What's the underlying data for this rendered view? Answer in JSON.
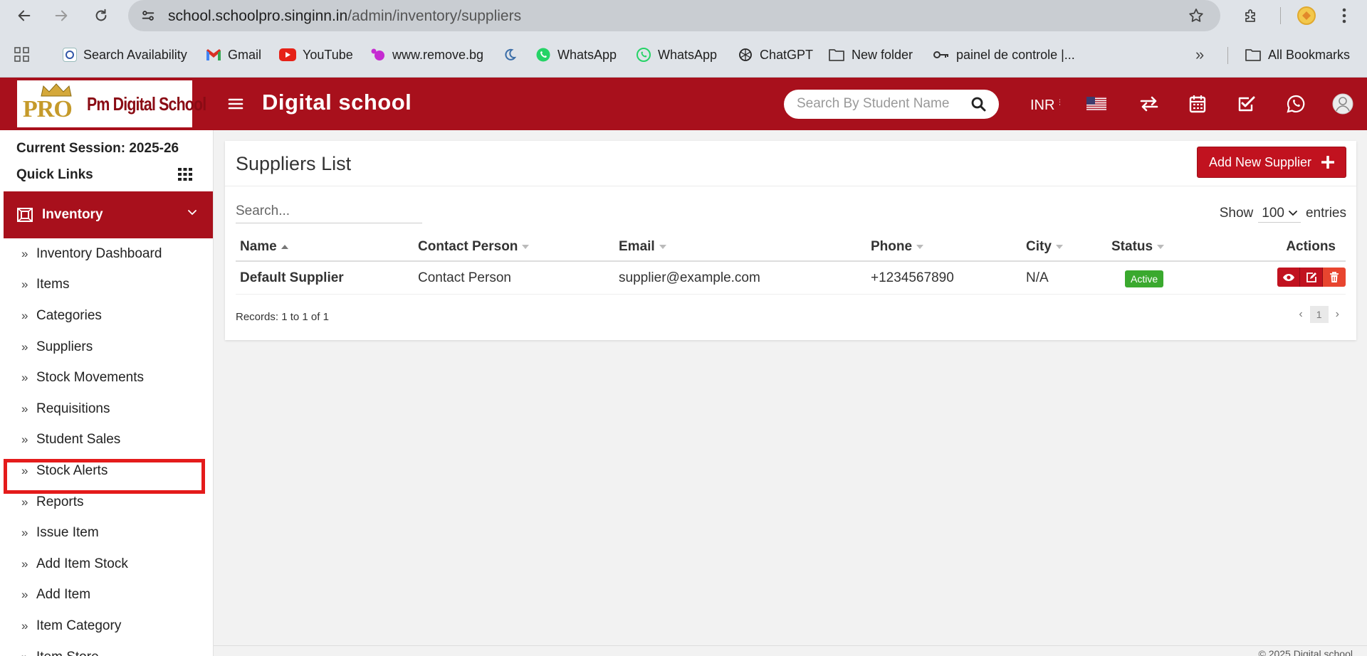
{
  "browser": {
    "url_host": "school.schoolpro.singinn.in",
    "url_path": "/admin/inventory/suppliers",
    "bookmarks": [
      {
        "label": "Search Availability",
        "icon": "site-icon"
      },
      {
        "label": "Gmail",
        "icon": "gmail-icon"
      },
      {
        "label": "YouTube",
        "icon": "youtube-icon"
      },
      {
        "label": "www.remove.bg",
        "icon": "removebg-icon"
      },
      {
        "label": "",
        "icon": "moon-icon"
      },
      {
        "label": "WhatsApp",
        "icon": "whatsapp-icon"
      },
      {
        "label": "WhatsApp",
        "icon": "whatsapp-outline-icon"
      },
      {
        "label": "ChatGPT",
        "icon": "chatgpt-icon"
      },
      {
        "label": "New folder",
        "icon": "folder-icon"
      },
      {
        "label": "painel de controle |...",
        "icon": "key-icon"
      }
    ],
    "more": "»",
    "all_bookmarks": "All Bookmarks"
  },
  "header": {
    "logo_pro": "PRO",
    "logo_name": "Pm Digital School",
    "title": "Digital school",
    "search_placeholder": "Search By Student Name",
    "currency": "INR ₹"
  },
  "sidebar": {
    "session": "Current Session: 2025-26",
    "quick_links": "Quick Links",
    "section": "Inventory",
    "items": [
      {
        "label": "Inventory Dashboard"
      },
      {
        "label": "Items"
      },
      {
        "label": "Categories"
      },
      {
        "label": "Suppliers"
      },
      {
        "label": "Stock Movements"
      },
      {
        "label": "Requisitions"
      },
      {
        "label": "Student Sales"
      },
      {
        "label": "Stock Alerts"
      },
      {
        "label": "Reports"
      },
      {
        "label": "Issue Item"
      },
      {
        "label": "Add Item Stock"
      },
      {
        "label": "Add Item"
      },
      {
        "label": "Item Category"
      },
      {
        "label": "Item Store"
      }
    ],
    "active_item": "Suppliers"
  },
  "main": {
    "title": "Suppliers List",
    "add_button": "Add New Supplier",
    "search_placeholder": "Search...",
    "show_label": "Show",
    "entries_value": "100",
    "entries_label": "entries",
    "columns": [
      "Name",
      "Contact Person",
      "Email",
      "Phone",
      "City",
      "Status",
      "Actions"
    ],
    "rows": [
      {
        "name": "Default Supplier",
        "contact": "Contact Person",
        "email": "supplier@example.com",
        "phone": "+1234567890",
        "city": "N/A",
        "status": "Active"
      }
    ],
    "records": "Records: 1 to 1 of 1",
    "page": "1",
    "prev": "‹",
    "next": "›"
  },
  "footer": {
    "text": "© 2025 Digital school"
  },
  "colors": {
    "brand": "#a8101c",
    "button": "#c1121f",
    "status_active": "#3aa92e",
    "highlight": "#e41b1b"
  }
}
